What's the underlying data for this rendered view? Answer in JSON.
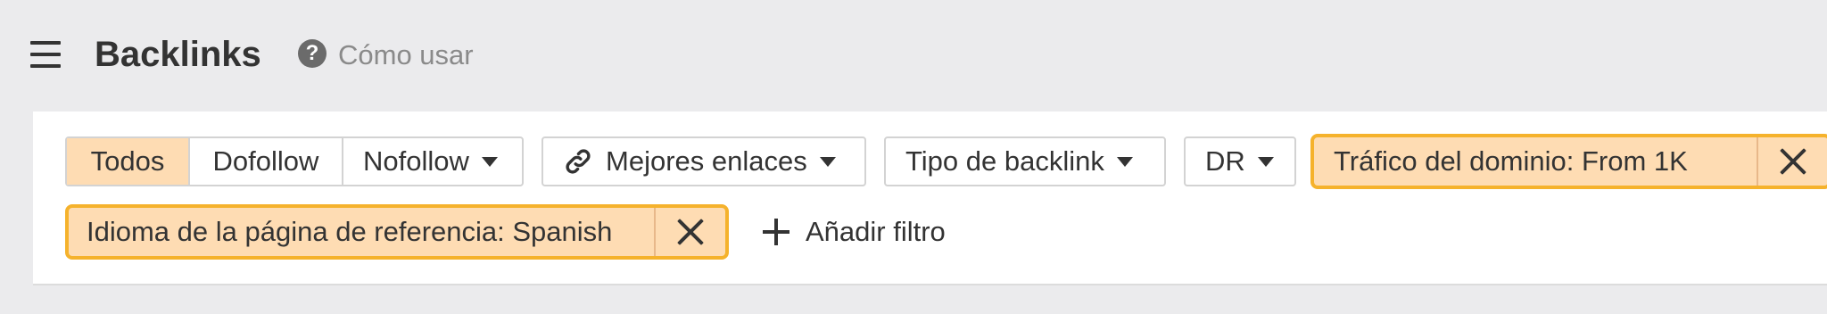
{
  "header": {
    "title": "Backlinks",
    "help_label": "Cómo usar",
    "help_icon_glyph": "?"
  },
  "filters": {
    "link_type": {
      "options": [
        "Todos",
        "Dofollow",
        "Nofollow"
      ],
      "active": "Todos"
    },
    "best_links_label": "Mejores enlaces",
    "backlink_type_label": "Tipo de backlink",
    "dr_label": "DR",
    "domain_traffic_chip": "Tráfico del dominio: From 1K",
    "language_chip": "Idioma de la página de referencia: Spanish",
    "add_filter_label": "Añadir filtro"
  },
  "colors": {
    "accent_fill": "#fedcb3",
    "accent_border": "#f5b22c",
    "page_background": "#ebebed"
  }
}
